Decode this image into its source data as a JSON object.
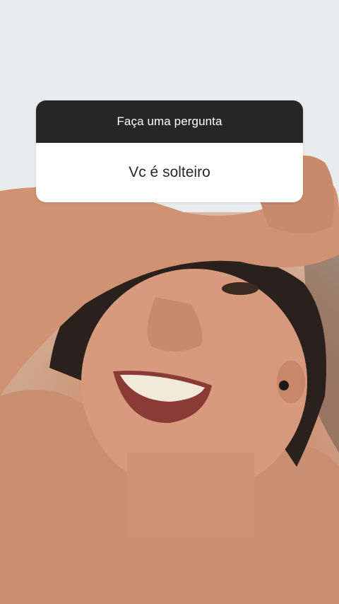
{
  "story": {
    "question_sticker": {
      "prompt": "Faça uma pergunta",
      "answer": "Vc é solteiro"
    },
    "colors": {
      "sticker_header_bg": "#262626",
      "sticker_body_bg": "#ffffff",
      "sticker_header_text": "#ffffff",
      "sticker_body_text": "#262626"
    }
  }
}
